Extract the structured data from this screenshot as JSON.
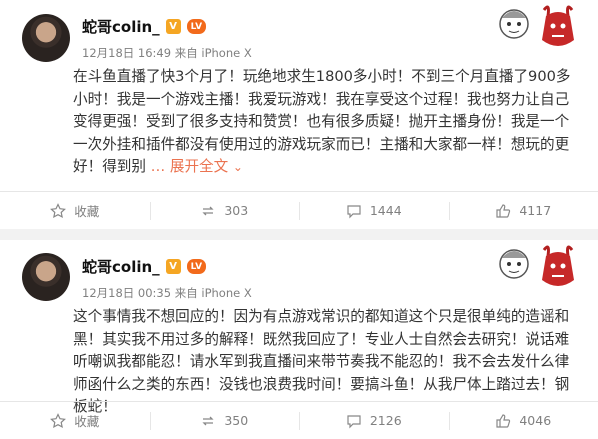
{
  "posts": [
    {
      "username": "蛇哥colin_",
      "vip_badge": "V",
      "level_badge": "LV",
      "meta": "12月18日 16:49 来自 iPhone X",
      "text": "在斗鱼直播了快3个月了！玩绝地求生1800多小时！不到三个月直播了900多小时！我是一个游戏主播！我爱玩游戏！我在享受这个过程！我也努力让自己变得更强！受到了很多支持和赞赏！也有很多质疑！抛开主播身份！我是一个一次外挂和插件都没有使用过的游戏玩家而已！主播和大家都一样！想玩的更好！得到别",
      "expand_label": "… 展开全文",
      "expand_arrow": "⌄",
      "actions": {
        "favorite": "收藏",
        "repost": "303",
        "comment": "1444",
        "like": "4117"
      }
    },
    {
      "username": "蛇哥colin_",
      "vip_badge": "V",
      "level_badge": "LV",
      "meta": "12月18日 00:35 来自 iPhone X",
      "text": "这个事情我不想回应的！因为有点游戏常识的都知道这个只是很单纯的造谣和黑！其实我不用过多的解释！既然我回应了！专业人士自然会去研究！说话难听嘲讽我都能忍！请水军到我直播间来带节奏我不能忍的！我不会去发什么律师函什么之类的东西！没钱也浪费我时间！要搞斗鱼！从我尸体上踏过去！钢板蛇！",
      "actions": {
        "favorite": "收藏",
        "repost": "350",
        "comment": "2126",
        "like": "4046"
      }
    }
  ],
  "colors": {
    "accent": "#eb7350",
    "vip": "#f5a623",
    "level": "#f26a1b",
    "meta": "#808080"
  },
  "icons": [
    "star-icon",
    "repost-icon",
    "comment-icon",
    "like-icon"
  ]
}
